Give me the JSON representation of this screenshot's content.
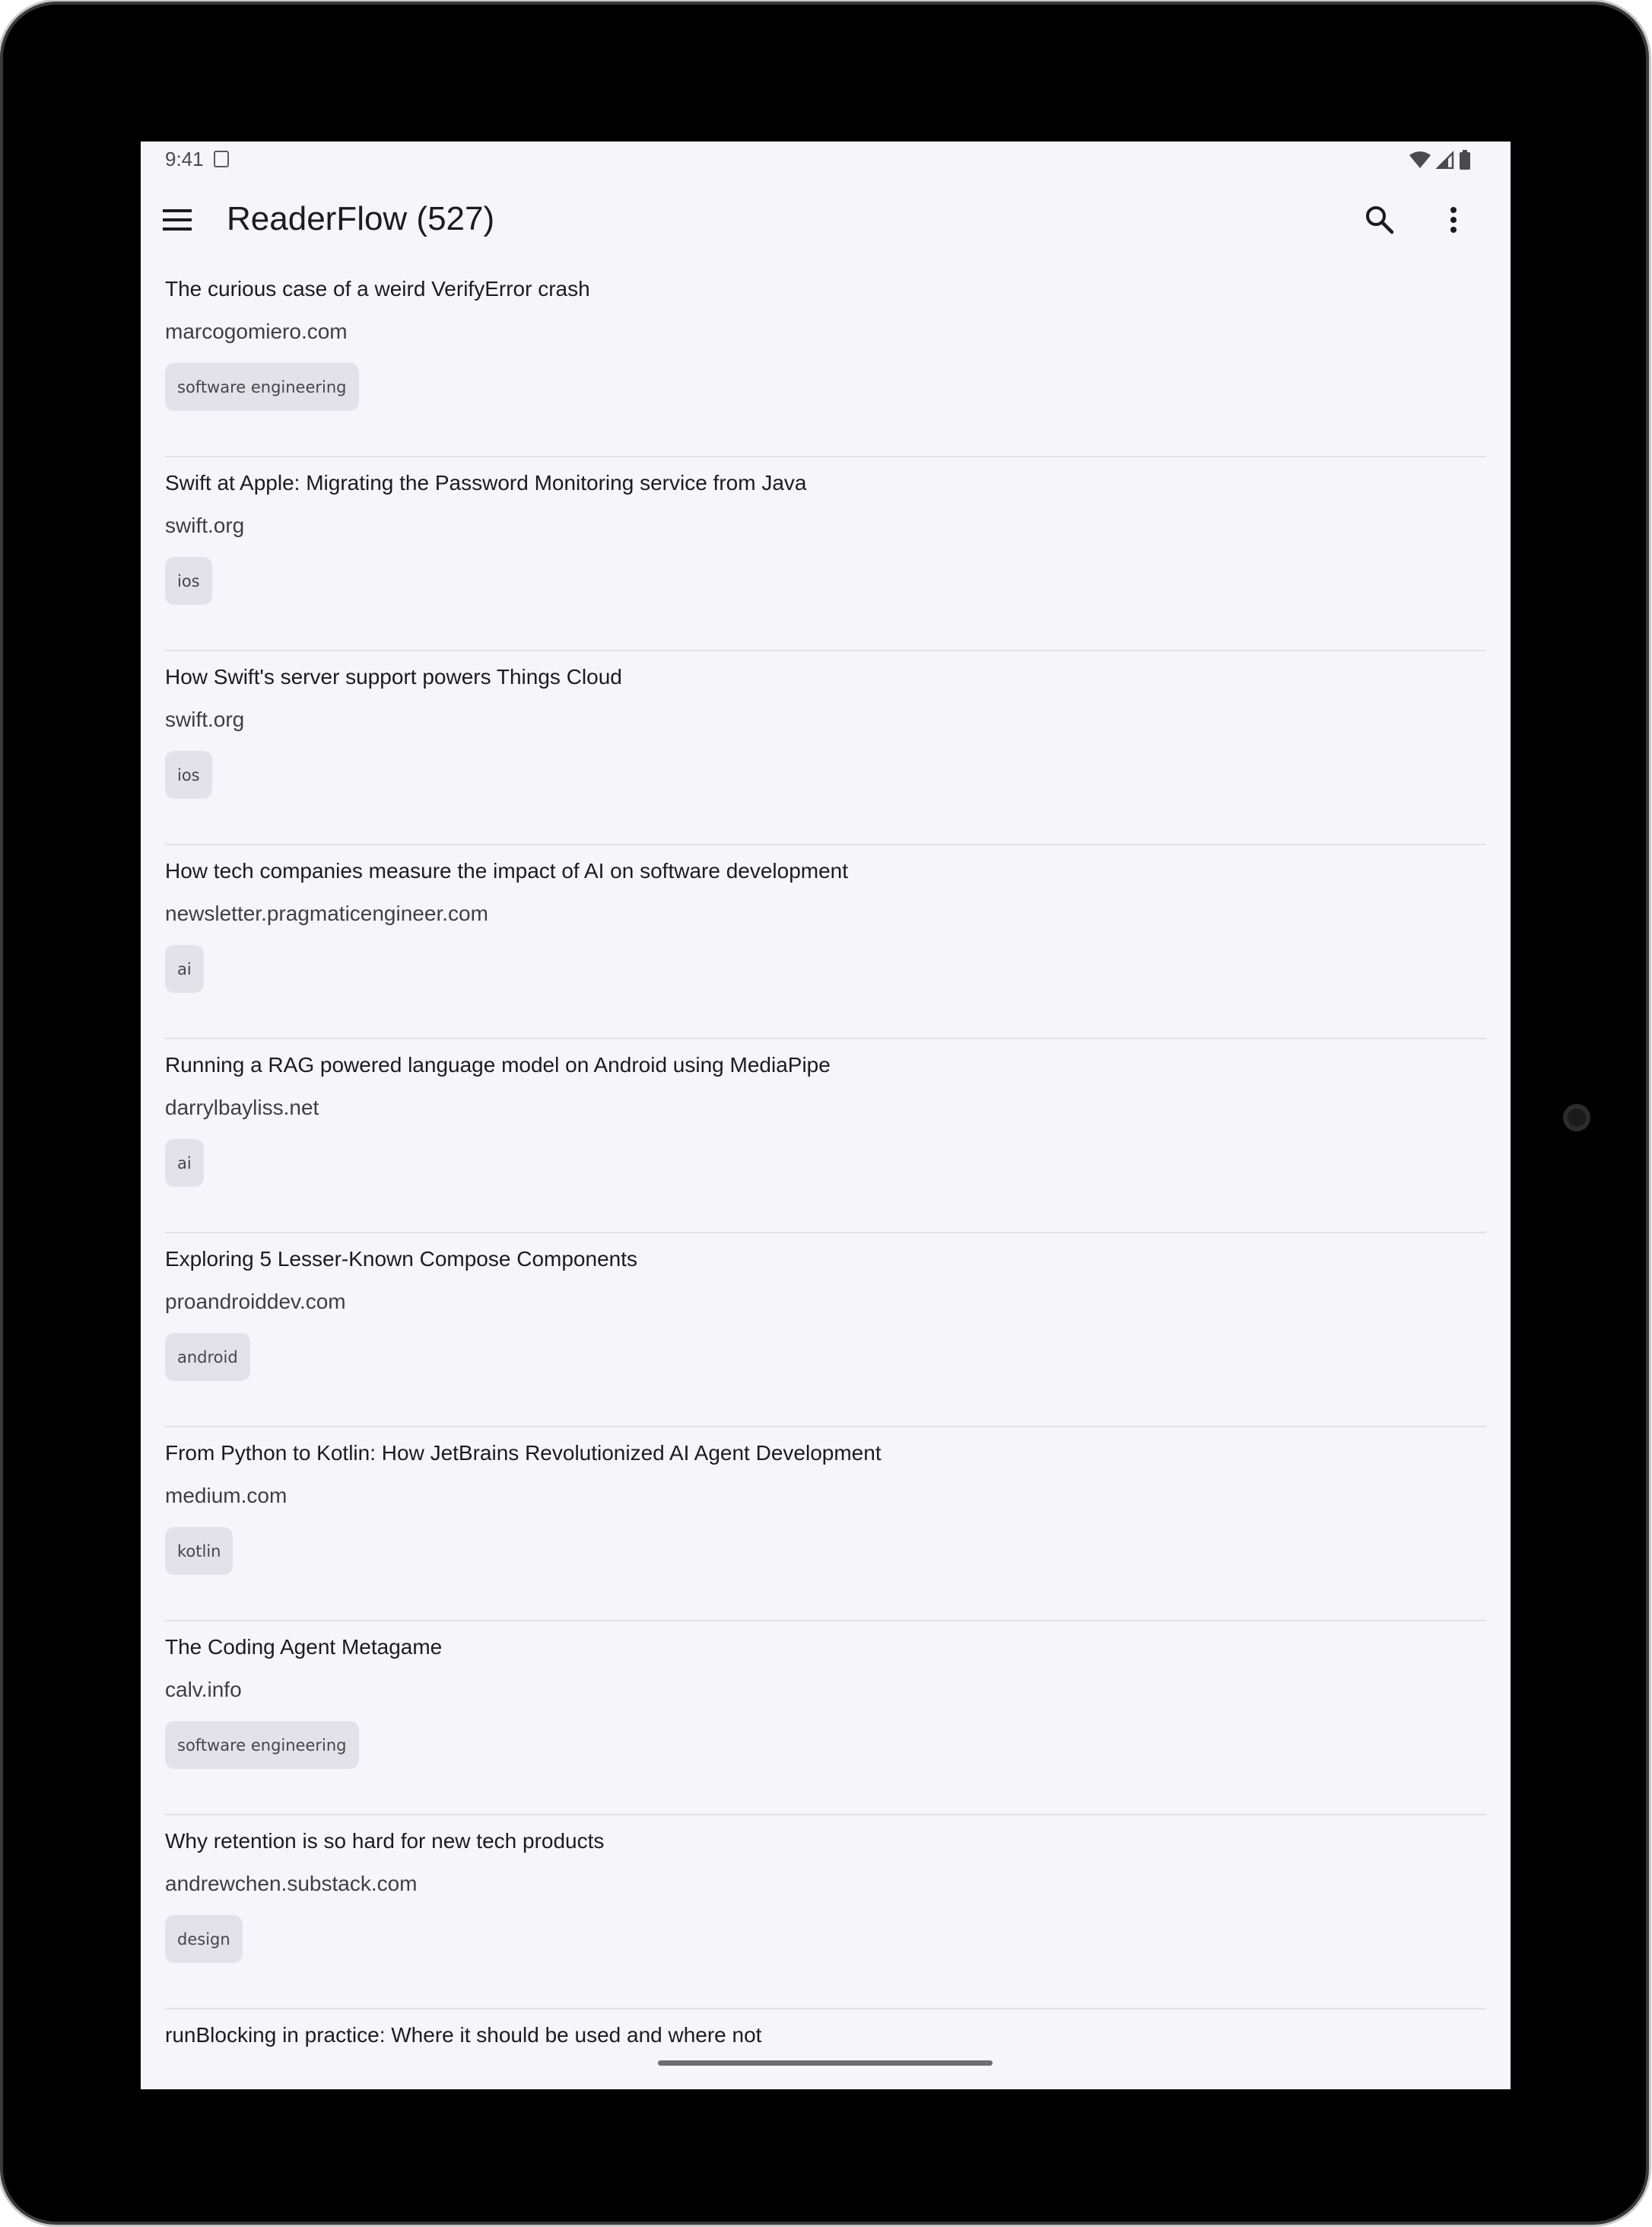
{
  "status_bar": {
    "time": "9:41"
  },
  "app_bar": {
    "title": "ReaderFlow (527)",
    "menu_icon": "hamburger-menu-icon",
    "search_icon": "search-icon",
    "more_icon": "more-vert-icon"
  },
  "articles": [
    {
      "title": "The curious case of a weird VerifyError crash",
      "domain": "marcogomiero.com",
      "tag": "software engineering"
    },
    {
      "title": "Swift at Apple: Migrating the Password Monitoring service from Java",
      "domain": "swift.org",
      "tag": "ios"
    },
    {
      "title": "How Swift's server support powers Things Cloud",
      "domain": "swift.org",
      "tag": "ios"
    },
    {
      "title": "How tech companies measure the impact of AI on software development",
      "domain": "newsletter.pragmaticengineer.com",
      "tag": "ai"
    },
    {
      "title": "Running a RAG powered language model on Android using MediaPipe",
      "domain": "darrylbayliss.net",
      "tag": "ai"
    },
    {
      "title": "Exploring 5 Lesser-Known Compose Components",
      "domain": "proandroiddev.com",
      "tag": "android"
    },
    {
      "title": "From Python to Kotlin: How JetBrains Revolutionized AI Agent Development",
      "domain": "medium.com",
      "tag": "kotlin"
    },
    {
      "title": "The Coding Agent Metagame",
      "domain": "calv.info",
      "tag": "software engineering"
    },
    {
      "title": "Why retention is so hard for new tech products",
      "domain": "andrewchen.substack.com",
      "tag": "design"
    },
    {
      "title": "runBlocking in practice: Where it should be used and where not",
      "domain": "",
      "tag": ""
    }
  ]
}
